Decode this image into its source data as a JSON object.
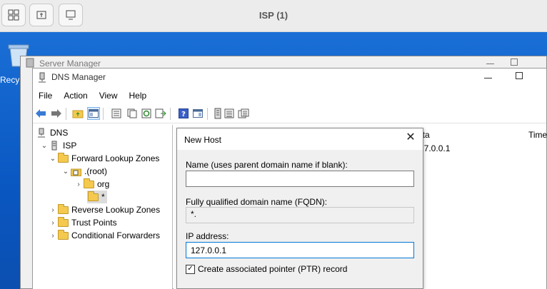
{
  "vm": {
    "title": "ISP (1)",
    "buttons": [
      {
        "name": "view-switch-icon"
      },
      {
        "name": "usb-connect-icon"
      },
      {
        "name": "display-icon"
      }
    ]
  },
  "desktop": {
    "recycle_label": "Recy"
  },
  "server_manager": {
    "title": "Server Manager"
  },
  "dns_manager": {
    "title": "DNS Manager",
    "menu": [
      "File",
      "Action",
      "View",
      "Help"
    ],
    "tree": {
      "root": "DNS",
      "server": "ISP",
      "forward": "Forward Lookup Zones",
      "zone_root": ".(root)",
      "org": "org",
      "wildcard": "*",
      "reverse": "Reverse Lookup Zones",
      "trust": "Trust Points",
      "conditional": "Conditional Forwarders"
    },
    "list": {
      "col_data": "ata",
      "col_time": "Time",
      "row_value": "27.0.0.1"
    }
  },
  "new_host": {
    "title": "New Host",
    "name_label": "Name (uses parent domain name if blank):",
    "name_value": "",
    "fqdn_label": "Fully qualified domain name (FQDN):",
    "fqdn_value": "*.",
    "ip_label": "IP address:",
    "ip_value": "127.0.0.1",
    "ptr_label": "Create associated pointer (PTR) record",
    "ptr_checked": true
  }
}
